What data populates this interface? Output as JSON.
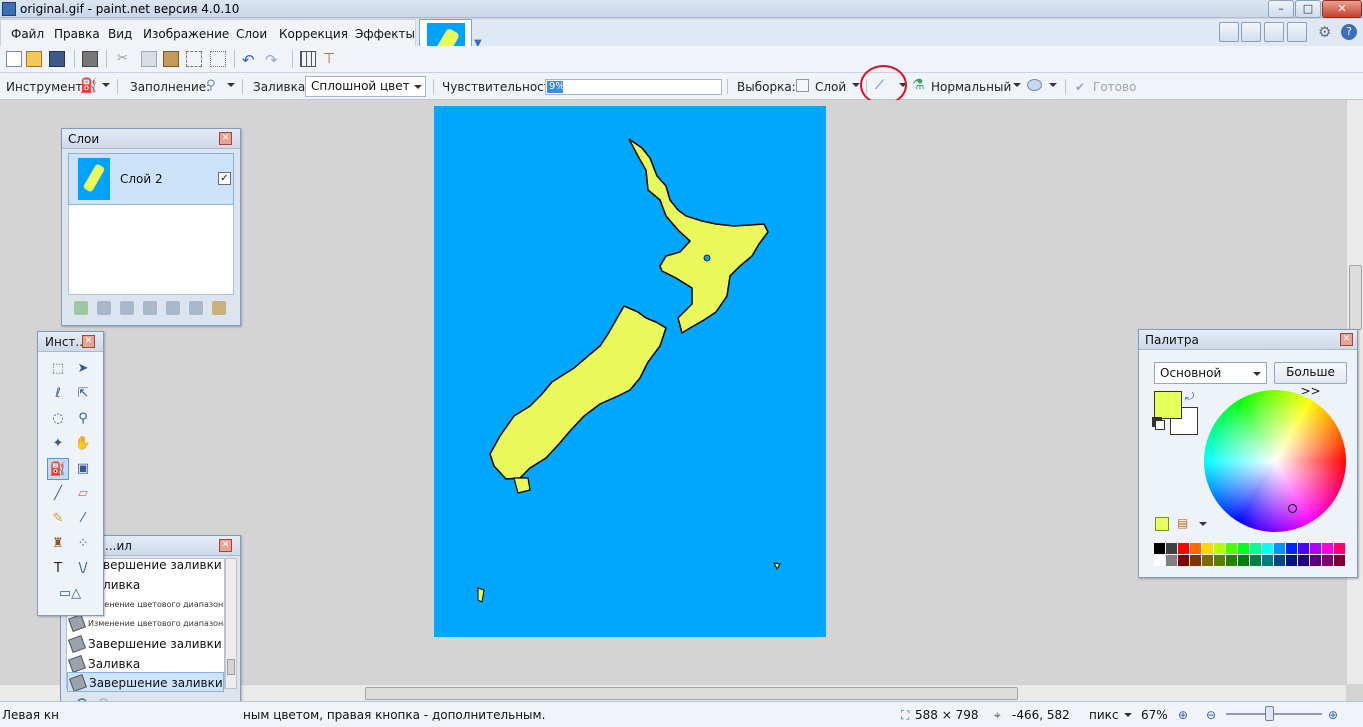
{
  "window": {
    "title": "original.gif - paint.net версия 4.0.10"
  },
  "menu": [
    "Файл",
    "Правка",
    "Вид",
    "Изображение",
    "Слои",
    "Коррекция",
    "Эффекты"
  ],
  "options": {
    "tool_label": "Инструмент:",
    "fill_mode_label": "Заполнение:",
    "fill_label": "Заливка:",
    "fill_value": "Сплошной цвет",
    "tolerance_label": "Чувствительность:",
    "tolerance_value": "9%",
    "tolerance_fraction": 0.09,
    "sampling_label": "Выборка:",
    "sampling_value": "Слой",
    "blend_value": "Нормальный",
    "done_label": "Готово"
  },
  "layers_panel": {
    "title": "Слои",
    "layers": [
      {
        "name": "Слой 2",
        "visible": true
      }
    ]
  },
  "tools_panel": {
    "title": "Инст..."
  },
  "history_panel": {
    "title": "...ил",
    "items": [
      {
        "label": "Завершение заливки",
        "style": "normal"
      },
      {
        "label": "Заливка",
        "style": "normal"
      },
      {
        "label": "Изменение цветового диапазона",
        "style": "small"
      },
      {
        "label": "Изменение цветового диапазона",
        "style": "small"
      },
      {
        "label": "Завершение заливки",
        "style": "normal"
      },
      {
        "label": "Заливка",
        "style": "normal"
      },
      {
        "label": "Завершение заливки",
        "style": "selected"
      }
    ]
  },
  "palette_panel": {
    "title": "Палитра",
    "palette_name": "Основной",
    "more_label": "Больше >>",
    "primary_color": "#e6ff5a",
    "secondary_color": "#ffffff",
    "swatches_row1": [
      "#000000",
      "#404040",
      "#ff0000",
      "#ff6a00",
      "#ffd800",
      "#b6ff00",
      "#4cff00",
      "#00ff21",
      "#00ff90",
      "#00ffff",
      "#0094ff",
      "#0026ff",
      "#4800ff",
      "#b200ff",
      "#ff00dc",
      "#ff006e"
    ],
    "swatches_row2": [
      "#ffffff",
      "#808080",
      "#7f0000",
      "#7f3300",
      "#7f6a00",
      "#5b7f00",
      "#267f00",
      "#007f0e",
      "#007f46",
      "#007f7f",
      "#004a7f",
      "#00137f",
      "#21007f",
      "#57007f",
      "#7f006e",
      "#7f0037"
    ]
  },
  "image": {
    "background_color": "#00a7ff",
    "land_color": "#e9f95c"
  },
  "status": {
    "hint": "Левая кнопка - заливка основным цветом, правая кнопка - дополнительным.",
    "hint_visible": "Левая кн",
    "hint_tail": "ным цветом, правая кнопка - дополнительным.",
    "image_size": "588 × 798",
    "cursor_pos": "-466, 582",
    "units": "пикс",
    "zoom": "67%"
  }
}
